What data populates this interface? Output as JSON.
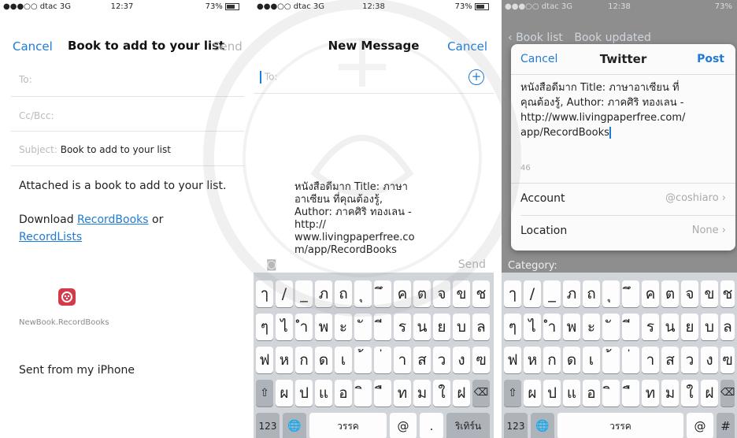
{
  "colors": {
    "accent": "#1e7bd7",
    "logo": "#d33a4a",
    "keyboard": "#d1d4d9"
  },
  "status": [
    {
      "carrier": "●●●○○ dtac  3G",
      "time": "12:37",
      "battery": "73%"
    },
    {
      "carrier": "●●●○○ dtac  3G",
      "time": "12:38",
      "battery": "73%"
    },
    {
      "carrier": "●●●○○ dtac  3G",
      "time": "12:38",
      "battery": "73%"
    }
  ],
  "mail": {
    "cancel": "Cancel",
    "title": "Book to add to your list",
    "send": "Send",
    "to_label": "To:",
    "cc_label": "Cc/Bcc:",
    "subject_label": "Subject:",
    "subject_value": "Book to add to your list",
    "body_intro": "Attached is a book to add to your list.",
    "download_prefix": "Download ",
    "link_recordbooks": "RecordBooks",
    "or_text": " or",
    "link_recordlists": "RecordLists",
    "attachment_name": "NewBook.RecordBooks",
    "signature": "Sent from my iPhone"
  },
  "message": {
    "title": "New Message",
    "cancel": "Cancel",
    "to_label": "To:",
    "bubble_lines": [
      "หนังสือดีมาก Title: ภาษา",
      "อาเซียน ที่คุณต้องรู้,",
      "Author: ภาคศิริ ทองเลน -",
      "http://",
      "www.livingpaperfree.co",
      "m/app/RecordBooks"
    ],
    "send": "Send"
  },
  "twitter": {
    "behind_left": "Book list",
    "behind_title": "Book updated",
    "cancel": "Cancel",
    "title": "Twitter",
    "post": "Post",
    "text_lines": [
      "หนังสือดีมาก Title: ภาษาอาเซียน ที่",
      "คุณต้องรู้, Author: ภาคศิริ ทองเลน -",
      "http://www.livingpaperfree.com/",
      "app/RecordBooks"
    ],
    "char_count": "46",
    "account_label": "Account",
    "account_value": "@coshiaro",
    "location_label": "Location",
    "location_value": "None",
    "category_label": "Category:"
  },
  "keyboard": {
    "row1": [
      "ๅ",
      "/",
      "_",
      "ภ",
      "ถ",
      "ุ",
      "ึ",
      "ค",
      "ต",
      "จ",
      "ข",
      "ช"
    ],
    "row2": [
      "ๆ",
      "ไ",
      "ำ",
      "พ",
      "ะ",
      "ั",
      "ี",
      "ร",
      "น",
      "ย",
      "บ",
      "ล"
    ],
    "row3": [
      "ฟ",
      "ห",
      "ก",
      "ด",
      "เ",
      "้",
      "่",
      "า",
      "ส",
      "ว",
      "ง",
      "ฃ"
    ],
    "row4": [
      "ผ",
      "ป",
      "แ",
      "อ",
      "ิ",
      "ื",
      "ท",
      "ม",
      "ใ",
      "ฝ"
    ],
    "shift": "⇧",
    "backspace": "⌫",
    "num_label": "123",
    "globe": "🌐",
    "space_label": "วรรค",
    "at": "@",
    "dot": ".",
    "return_label": "ริเทิร์น"
  }
}
